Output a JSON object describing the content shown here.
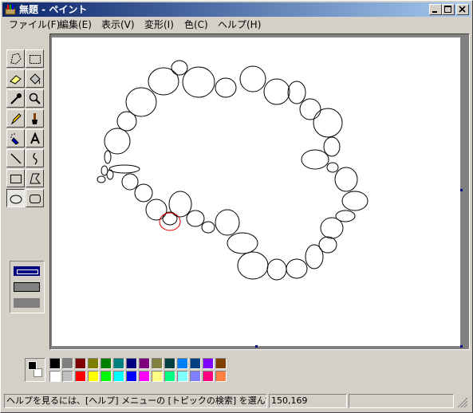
{
  "window": {
    "title": "無題 - ペイント"
  },
  "title_buttons": {
    "minimize": "minimize-icon",
    "maximize": "maximize-icon",
    "close": "close-icon"
  },
  "menu": [
    {
      "label": "ファイル(F)"
    },
    {
      "label": "編集(E)"
    },
    {
      "label": "表示(V)"
    },
    {
      "label": "変形(I)"
    },
    {
      "label": "色(C)"
    },
    {
      "label": "ヘルプ(H)"
    }
  ],
  "tools": [
    "free-form-select-icon",
    "select-icon",
    "eraser-icon",
    "fill-icon",
    "pick-color-icon",
    "magnifier-icon",
    "pencil-icon",
    "brush-icon",
    "airbrush-icon",
    "text-icon",
    "line-icon",
    "curve-icon",
    "rectangle-icon",
    "polygon-icon",
    "ellipse-icon",
    "rounded-rectangle-icon"
  ],
  "active_tool": "ellipse-icon",
  "palette": {
    "foreground": "#000000",
    "background": "#ffffff",
    "row1": [
      "#000000",
      "#808080",
      "#800000",
      "#808000",
      "#008000",
      "#008080",
      "#000080",
      "#800080",
      "#808040",
      "#004040",
      "#0080ff",
      "#004080",
      "#8000ff",
      "#804000"
    ],
    "row2": [
      "#ffffff",
      "#c0c0c0",
      "#ff0000",
      "#ffff00",
      "#00ff00",
      "#00ffff",
      "#0000ff",
      "#ff00ff",
      "#ffff80",
      "#00ff80",
      "#80ffff",
      "#8080ff",
      "#ff0080",
      "#ff8040"
    ]
  },
  "status": {
    "help_text": "ヘルプを見るには、[ヘルプ] メニューの [トピックの検索] を選んでください。",
    "coords": "150,169",
    "size": ""
  }
}
